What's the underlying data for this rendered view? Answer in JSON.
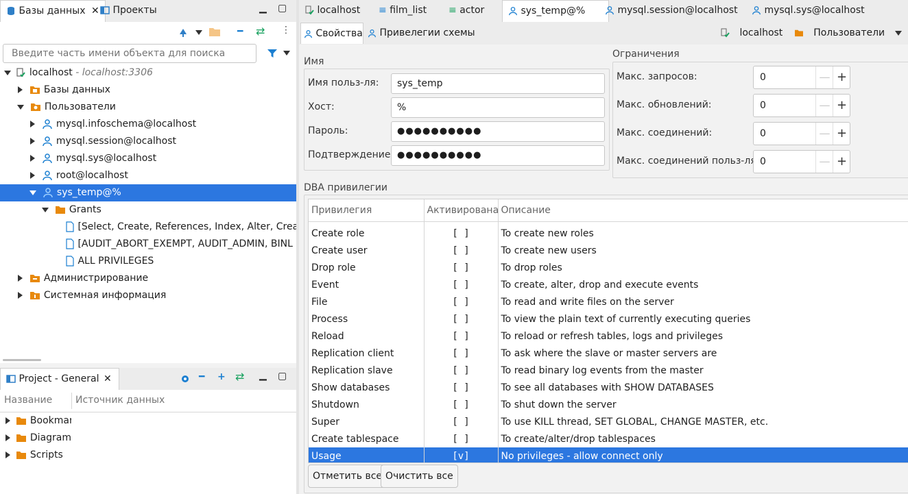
{
  "left_tabs": {
    "databases": "Базы данных",
    "projects": "Проекты"
  },
  "search": {
    "placeholder": "Введите часть имени объекта для поиска"
  },
  "tree": {
    "root": {
      "label": "localhost",
      "detail": " - localhost:3306"
    },
    "items": [
      {
        "label": "Базы данных"
      },
      {
        "label": "Пользователи"
      },
      {
        "label": "mysql.infoschema@localhost"
      },
      {
        "label": "mysql.session@localhost"
      },
      {
        "label": "mysql.sys@localhost"
      },
      {
        "label": "root@localhost"
      },
      {
        "label": "sys_temp@%"
      },
      {
        "label": "Grants"
      },
      {
        "label": "[Select, Create, References, Index, Alter, Create t"
      },
      {
        "label": "[AUDIT_ABORT_EXEMPT, AUDIT_ADMIN, BINL"
      },
      {
        "label": "ALL PRIVILEGES"
      },
      {
        "label": "Администрирование"
      },
      {
        "label": "Системная информация"
      }
    ]
  },
  "project_panel": {
    "title": "Project - General",
    "col_name": "Название",
    "col_source": "Источник данных",
    "items": [
      "Bookmarks",
      "Diagrams",
      "Scripts"
    ]
  },
  "editor_tabs": [
    "localhost",
    "film_list",
    "actor",
    "sys_temp@%",
    "mysql.session@localhost",
    "mysql.sys@localhost"
  ],
  "sub_tabs": {
    "properties": "Свойства",
    "schema_privs": "Привелегии схемы"
  },
  "breadcrumb": {
    "conn": "localhost",
    "node": "Пользователи"
  },
  "name_group": {
    "title": "Имя",
    "username_label": "Имя польз-ля:",
    "username": "sys_temp",
    "host_label": "Хост:",
    "host": "%",
    "password_label": "Пароль:",
    "password": "●●●●●●●●●●",
    "confirm_label": "Подтверждение:",
    "confirm": "●●●●●●●●●●"
  },
  "limits_group": {
    "title": "Ограничения",
    "max_queries_label": "Макс. запросов:",
    "max_queries": "0",
    "max_updates_label": "Макс. обновлений:",
    "max_updates": "0",
    "max_connections_label": "Макс. соединений:",
    "max_connections": "0",
    "max_user_connections_label": "Макс. соединений польз-ля:",
    "max_user_connections": "0"
  },
  "dba": {
    "title": "DBA привилегии",
    "col_priv": "Привилегия",
    "col_active": "Активирована",
    "col_desc": "Описание",
    "rows": [
      {
        "priv": "Create role",
        "active": "[ ]",
        "desc": "To create new roles"
      },
      {
        "priv": "Create user",
        "active": "[ ]",
        "desc": "To create new users"
      },
      {
        "priv": "Drop role",
        "active": "[ ]",
        "desc": "To drop roles"
      },
      {
        "priv": "Event",
        "active": "[ ]",
        "desc": "To create, alter, drop and execute events"
      },
      {
        "priv": "File",
        "active": "[ ]",
        "desc": "To read and write files on the server"
      },
      {
        "priv": "Process",
        "active": "[ ]",
        "desc": "To view the plain text of currently executing queries"
      },
      {
        "priv": "Reload",
        "active": "[ ]",
        "desc": "To reload or refresh tables, logs and privileges"
      },
      {
        "priv": "Replication client",
        "active": "[ ]",
        "desc": "To ask where the slave or master servers are"
      },
      {
        "priv": "Replication slave",
        "active": "[ ]",
        "desc": "To read binary log events from the master"
      },
      {
        "priv": "Show databases",
        "active": "[ ]",
        "desc": "To see all databases with SHOW DATABASES"
      },
      {
        "priv": "Shutdown",
        "active": "[ ]",
        "desc": "To shut down the server"
      },
      {
        "priv": "Super",
        "active": "[ ]",
        "desc": "To use KILL thread, SET GLOBAL, CHANGE MASTER, etc."
      },
      {
        "priv": "Create tablespace",
        "active": "[ ]",
        "desc": "To create/alter/drop tablespaces"
      },
      {
        "priv": "Usage",
        "active": "[v]",
        "desc": "No privileges - allow connect only"
      }
    ],
    "select_all": "Отметить все",
    "clear_all": "Очистить все"
  },
  "colors": {
    "selection": "#2c77e0",
    "accent": "#1b7fd1",
    "folder": "#e8890c"
  }
}
